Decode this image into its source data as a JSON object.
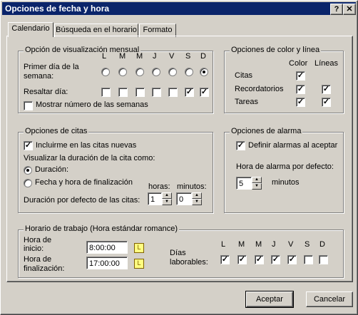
{
  "window": {
    "title": "Opciones de fecha y hora",
    "help_label": "?",
    "close_label": "✕"
  },
  "tabs": [
    "Calendario",
    "Búsqueda en el horario",
    "Formato"
  ],
  "monthly": {
    "legend": "Opción de visualización mensual",
    "days": [
      "L",
      "M",
      "M",
      "J",
      "V",
      "S",
      "D"
    ],
    "first_day_label": "Primer día de la semana:",
    "first_day_label_1": "Primer día de la",
    "first_day_label_2": "semana:",
    "first_day_selected": 6,
    "highlight_label": "Resaltar día:",
    "highlight": [
      false,
      false,
      false,
      false,
      false,
      true,
      true
    ],
    "week_numbers_label": "Mostrar número de las semanas",
    "week_numbers": false
  },
  "colors": {
    "legend": "Opciones de color y línea",
    "col_color": "Color",
    "col_lines": "Líneas",
    "rows": [
      {
        "label": "Citas",
        "color": true,
        "lines": null
      },
      {
        "label": "Recordatorios",
        "color": true,
        "lines": true
      },
      {
        "label": "Tareas",
        "color": true,
        "lines": true
      }
    ]
  },
  "appointments": {
    "legend": "Opciones de citas",
    "include_new_label": "Incluirme en las citas nuevas",
    "include_new": true,
    "duration_as_label": "Visualizar la duración de la cita como:",
    "opt_duration": "Duración:",
    "opt_datetime": "Fecha y hora de finalización",
    "selected": "duration",
    "hours_label": "horas:",
    "minutes_label": "minutos:",
    "default_duration_label": "Duración por defecto de las citas:",
    "hours": "1",
    "minutes": "0"
  },
  "alarm": {
    "legend": "Opciones de alarma",
    "set_on_accept_label": "Definir alarmas al aceptar",
    "set_on_accept": true,
    "default_time_label": "Hora de alarma por defecto:",
    "value": "5",
    "unit": "minutos"
  },
  "work": {
    "legend": "Horario de trabajo (Hora estándar romance)",
    "start_label_1": "Hora de",
    "start_label_2": "inicio:",
    "start": "8:00:00",
    "end_label_1": "Hora de",
    "end_label_2": "finalización:",
    "end": "17:00:00",
    "workdays_label_1": "Días",
    "workdays_label_2": "laborables:",
    "days": [
      "L",
      "M",
      "M",
      "J",
      "V",
      "S",
      "D"
    ],
    "workdays": [
      true,
      true,
      true,
      true,
      true,
      false,
      false
    ]
  },
  "buttons": {
    "accept": "Aceptar",
    "cancel": "Cancelar"
  }
}
